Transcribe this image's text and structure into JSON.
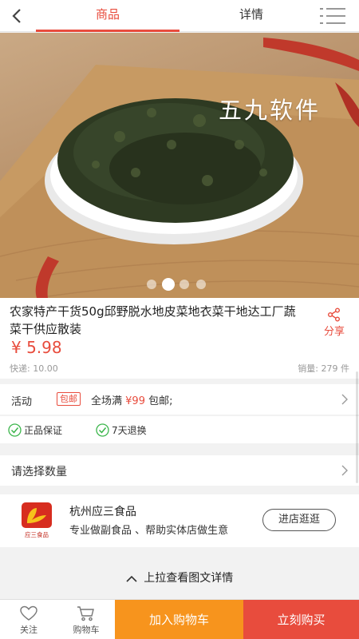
{
  "header": {
    "tabs": [
      {
        "label": "商品",
        "active": true
      },
      {
        "label": "详情",
        "active": false
      }
    ]
  },
  "hero": {
    "watermark": "五九软件",
    "image_count": 4,
    "active_index": 1
  },
  "product": {
    "title": "农家特产干货50g邱野脱水地皮菜地衣菜干地达工厂蔬菜干供应散装",
    "share_label": "分享",
    "price": "¥ 5.98",
    "shipping": "快递: 10.00",
    "sales": "销量: 279 件"
  },
  "activity": {
    "label": "活动",
    "badge": "包邮",
    "text_prefix": "全场满",
    "amount": "¥99",
    "text_suffix": "包邮;"
  },
  "guarantees": [
    {
      "label": "正品保证"
    },
    {
      "label": "7天退换"
    }
  ],
  "quantity": {
    "label": "请选择数量"
  },
  "store": {
    "logo_text": "应三食品",
    "name": "杭州应三食品",
    "description": "专业做副食品 、帮助实体店做生意",
    "visit_button": "进店逛逛"
  },
  "pull_up": {
    "label": "上拉查看图文详情"
  },
  "bottom_bar": {
    "favorite": "关注",
    "cart": "购物车",
    "add_to_cart": "加入购物车",
    "buy_now": "立刻购买"
  },
  "colors": {
    "accent": "#e84c3d",
    "orange": "#f7941d",
    "check_green": "#3ab54a"
  }
}
